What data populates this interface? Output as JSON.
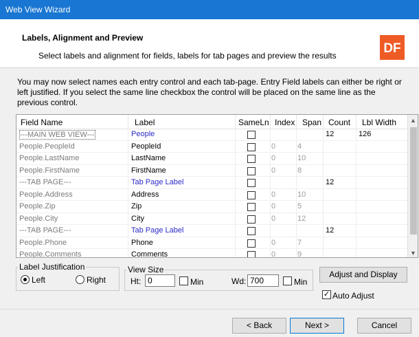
{
  "window": {
    "title": "Web View Wizard"
  },
  "header": {
    "title": "Labels, Alignment and Preview",
    "subtitle": "Select labels and alignment for fields, labels for tab pages and preview the results",
    "logo_text": "DF",
    "logo_color": "#ef5b25"
  },
  "intro": "You may now select names each entry control and each tab-page. Entry Field labels can either be right or left justified. If you select the same line checkbox the control will be placed on the same line as the previous control.",
  "grid": {
    "columns": [
      "Field Name",
      "Label",
      "SameLn",
      "Index",
      "Span",
      "Count",
      "Lbl Width"
    ],
    "rows": [
      {
        "field": "---MAIN WEB VIEW---",
        "label": "People",
        "label_blue": true,
        "index": "",
        "span": "",
        "count": "12",
        "lbl_width": "126"
      },
      {
        "field": "People.PeopleId",
        "label": "PeopleId",
        "label_blue": false,
        "index": "0",
        "span": "4",
        "count": "",
        "lbl_width": ""
      },
      {
        "field": "People.LastName",
        "label": "LastName",
        "label_blue": false,
        "index": "0",
        "span": "10",
        "count": "",
        "lbl_width": ""
      },
      {
        "field": "People.FirstName",
        "label": "FirstName",
        "label_blue": false,
        "index": "0",
        "span": "8",
        "count": "",
        "lbl_width": ""
      },
      {
        "field": "---TAB PAGE---",
        "label": "Tab Page Label",
        "label_blue": true,
        "index": "",
        "span": "",
        "count": "12",
        "lbl_width": ""
      },
      {
        "field": "People.Address",
        "label": "Address",
        "label_blue": false,
        "index": "0",
        "span": "10",
        "count": "",
        "lbl_width": ""
      },
      {
        "field": "People.Zip",
        "label": "Zip",
        "label_blue": false,
        "index": "0",
        "span": "5",
        "count": "",
        "lbl_width": ""
      },
      {
        "field": "People.City",
        "label": "City",
        "label_blue": false,
        "index": "0",
        "span": "12",
        "count": "",
        "lbl_width": ""
      },
      {
        "field": "---TAB PAGE---",
        "label": "Tab Page Label",
        "label_blue": true,
        "index": "",
        "span": "",
        "count": "12",
        "lbl_width": ""
      },
      {
        "field": "People.Phone",
        "label": "Phone",
        "label_blue": false,
        "index": "0",
        "span": "7",
        "count": "",
        "lbl_width": ""
      },
      {
        "field": "People.Comments",
        "label": "Comments",
        "label_blue": false,
        "index": "0",
        "span": "9",
        "count": "",
        "lbl_width": ""
      }
    ]
  },
  "label_justification": {
    "legend": "Label Justification",
    "left": "Left",
    "right": "Right",
    "selected": "Left"
  },
  "view_size": {
    "legend": "View Size",
    "ht_label": "Ht:",
    "ht_value": "0",
    "wd_label": "Wd:",
    "wd_value": "700",
    "min_label": "Min"
  },
  "adjust_button": "Adjust and Display",
  "auto_adjust": {
    "label": "Auto Adjust",
    "checked": true
  },
  "nav": {
    "back": "< Back",
    "next": "Next >",
    "cancel": "Cancel"
  }
}
